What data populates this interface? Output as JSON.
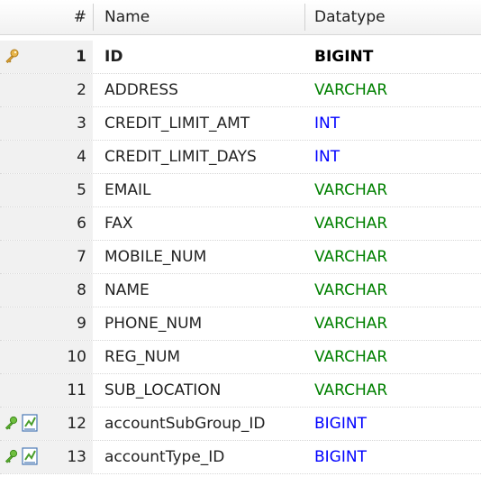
{
  "header": {
    "num": "#",
    "name": "Name",
    "datatype": "Datatype"
  },
  "colors": {
    "VARCHAR": "#008000",
    "INT": "#0000ff",
    "BIGINT_FK": "#0000ff",
    "BIGINT_PK": "#000000"
  },
  "rows": [
    {
      "num": "1",
      "name": "ID",
      "type": "BIGINT",
      "color": "#000000",
      "icons": [
        "key-icon"
      ]
    },
    {
      "num": "2",
      "name": "ADDRESS",
      "type": "VARCHAR",
      "color": "#008000",
      "icons": []
    },
    {
      "num": "3",
      "name": "CREDIT_LIMIT_AMT",
      "type": "INT",
      "color": "#0000ff",
      "icons": []
    },
    {
      "num": "4",
      "name": "CREDIT_LIMIT_DAYS",
      "type": "INT",
      "color": "#0000ff",
      "icons": []
    },
    {
      "num": "5",
      "name": "EMAIL",
      "type": "VARCHAR",
      "color": "#008000",
      "icons": []
    },
    {
      "num": "6",
      "name": "FAX",
      "type": "VARCHAR",
      "color": "#008000",
      "icons": []
    },
    {
      "num": "7",
      "name": "MOBILE_NUM",
      "type": "VARCHAR",
      "color": "#008000",
      "icons": []
    },
    {
      "num": "8",
      "name": "NAME",
      "type": "VARCHAR",
      "color": "#008000",
      "icons": []
    },
    {
      "num": "9",
      "name": "PHONE_NUM",
      "type": "VARCHAR",
      "color": "#008000",
      "icons": []
    },
    {
      "num": "10",
      "name": "REG_NUM",
      "type": "VARCHAR",
      "color": "#008000",
      "icons": []
    },
    {
      "num": "11",
      "name": "SUB_LOCATION",
      "type": "VARCHAR",
      "color": "#008000",
      "icons": []
    },
    {
      "num": "12",
      "name": "accountSubGroup_ID",
      "type": "BIGINT",
      "color": "#0000ff",
      "icons": [
        "foreign-key-icon",
        "index-icon"
      ]
    },
    {
      "num": "13",
      "name": "accountType_ID",
      "type": "BIGINT",
      "color": "#0000ff",
      "icons": [
        "foreign-key-icon",
        "index-icon"
      ]
    }
  ]
}
